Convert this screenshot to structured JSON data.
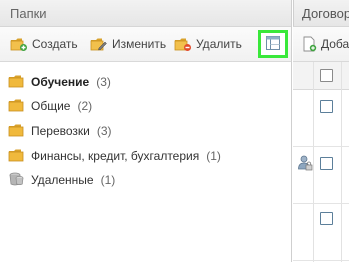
{
  "folders_panel": {
    "title": "Папки",
    "toolbar": {
      "create_label": "Создать",
      "edit_label": "Изменить",
      "delete_label": "Удалить",
      "view_button_icon": "table-view-icon"
    },
    "items": [
      {
        "name": "Обучение",
        "count": "(3)",
        "icon": "folder-icon",
        "active": true
      },
      {
        "name": "Общие",
        "count": "(2)",
        "icon": "folder-icon",
        "active": false
      },
      {
        "name": "Перевозки",
        "count": "(3)",
        "icon": "folder-icon",
        "active": false
      },
      {
        "name": "Финансы, кредит, бухгалтерия",
        "count": "(1)",
        "icon": "folder-icon",
        "active": false
      },
      {
        "name": "Удаленные",
        "count": "(1)",
        "icon": "trash-icon",
        "active": false
      }
    ]
  },
  "contracts_panel": {
    "title": "Договор",
    "toolbar": {
      "add_label": "Доба"
    },
    "rows": [
      {
        "has_user_icon": false
      },
      {
        "has_user_icon": true
      },
      {
        "has_user_icon": false
      }
    ]
  },
  "colors": {
    "highlight": "#39e83a",
    "folder": "#f0b93c",
    "checkbox_border": "#5c7f9a"
  }
}
